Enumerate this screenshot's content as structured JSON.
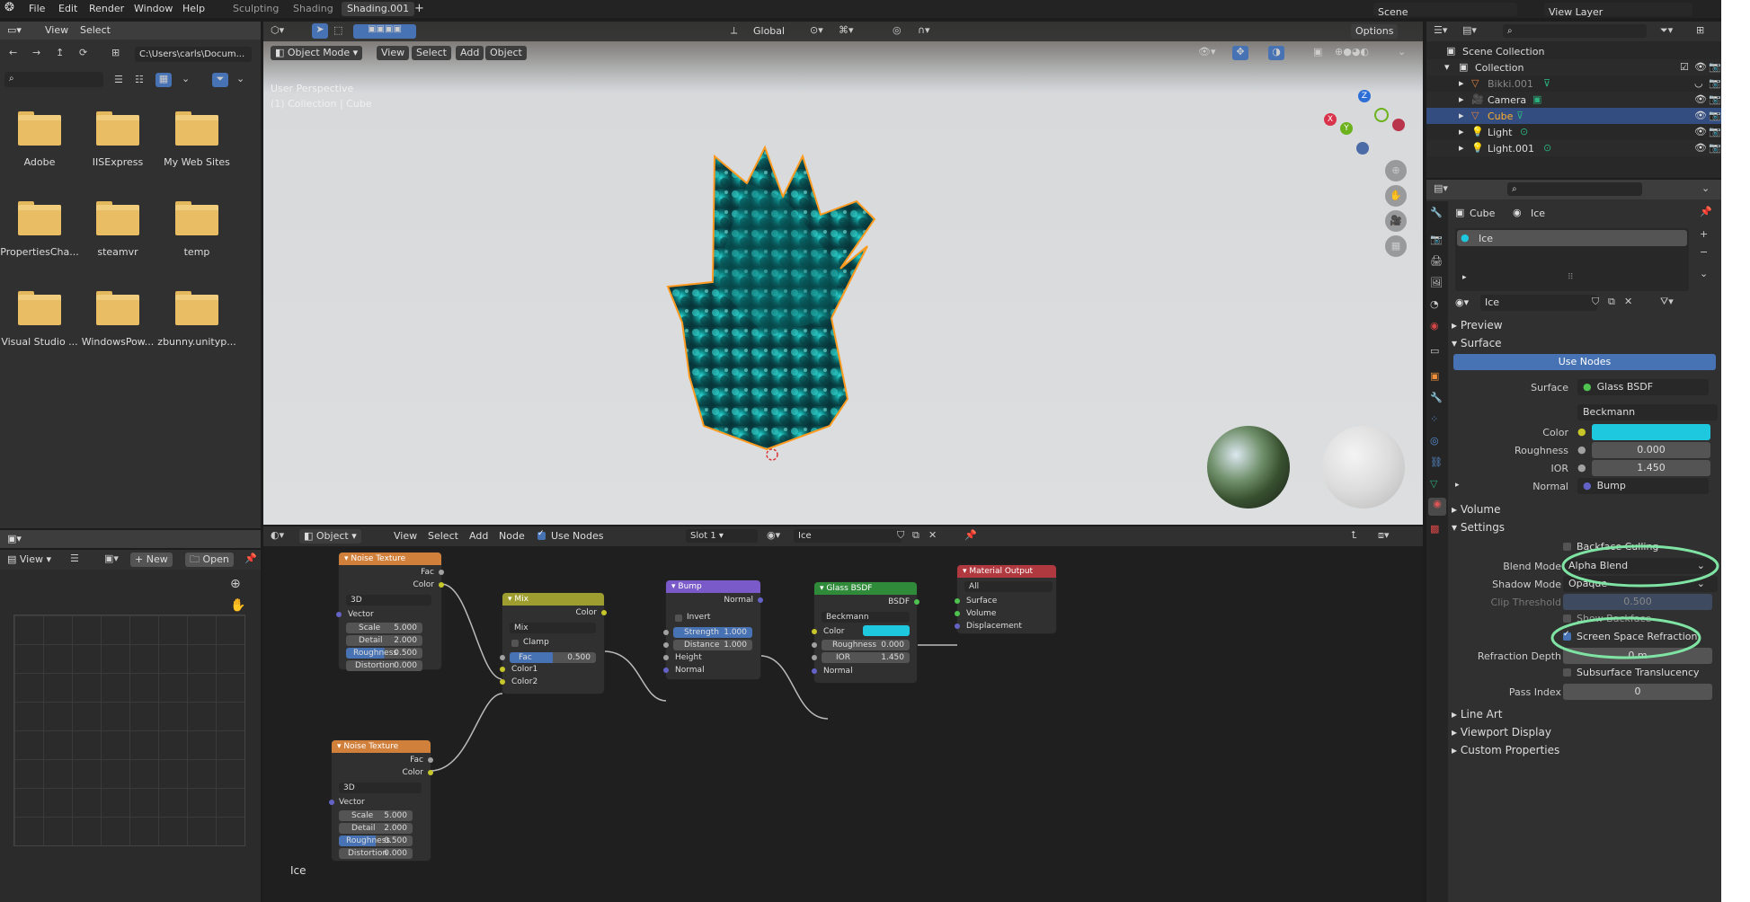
{
  "menubar": {
    "items": [
      "File",
      "Edit",
      "Render",
      "Window",
      "Help"
    ],
    "tabs": [
      "Sculpting",
      "Shading",
      "Shading.001"
    ],
    "plus": "+",
    "scene_label": "Scene",
    "view_layer_label": "View Layer"
  },
  "filebrowser": {
    "menu": [
      "View",
      "Select"
    ],
    "path": "C:\\Users\\carls\\Docum...",
    "folders": [
      "Adobe",
      "IISExpress",
      "My Web Sites",
      "PropertiesCha...",
      "steamvr",
      "temp",
      "Visual Studio ...",
      "WindowsPow...",
      "zbunny.unityp..."
    ]
  },
  "imageeditor": {
    "view": "View",
    "new": "New",
    "open": "Open"
  },
  "viewport": {
    "mode": "Object Mode",
    "menu": [
      "View",
      "Select",
      "Add",
      "Object"
    ],
    "orientation": "Global",
    "options": "Options",
    "line1": "User Perspective",
    "line2": "(1) Collection | Cube"
  },
  "nodeeditor": {
    "type": "Object",
    "menu": [
      "View",
      "Select",
      "Add",
      "Node"
    ],
    "use_nodes": "Use Nodes",
    "slot": "Slot 1",
    "material": "Ice",
    "frame_label": "Ice"
  },
  "nodes": {
    "noise1": {
      "title": "Noise Texture",
      "fac": "Fac",
      "color": "Color",
      "dim": "3D",
      "vector": "Vector",
      "scale": "Scale",
      "scale_v": "5.000",
      "detail": "Detail",
      "detail_v": "2.000",
      "rough": "Roughness",
      "rough_v": "0.500",
      "dist": "Distortion",
      "dist_v": "0.000"
    },
    "noise2": {
      "title": "Noise Texture",
      "fac": "Fac",
      "color": "Color",
      "dim": "3D",
      "vector": "Vector",
      "scale": "Scale",
      "scale_v": "5.000",
      "detail": "Detail",
      "detail_v": "2.000",
      "rough": "Roughness",
      "rough_v": "0.500",
      "dist": "Distortion",
      "dist_v": "0.000"
    },
    "mix": {
      "title": "Mix",
      "color": "Color",
      "mode": "Mix",
      "clamp": "Clamp",
      "fac": "Fac",
      "fac_v": "0.500",
      "c1": "Color1",
      "c2": "Color2"
    },
    "bump": {
      "title": "Bump",
      "normal": "Normal",
      "invert": "Invert",
      "strength": "Strength",
      "strength_v": "1.000",
      "distance": "Distance",
      "distance_v": "1.000",
      "height": "Height",
      "normal_in": "Normal"
    },
    "glass": {
      "title": "Glass BSDF",
      "bsdf": "BSDF",
      "dist": "Beckmann",
      "color": "Color",
      "rough": "Roughness",
      "rough_v": "0.000",
      "ior": "IOR",
      "ior_v": "1.450",
      "normal": "Normal",
      "swatch": "#1ec9e0"
    },
    "output": {
      "title": "Material Output",
      "target": "All",
      "surface": "Surface",
      "volume": "Volume",
      "disp": "Displacement"
    }
  },
  "outliner": {
    "root": "Scene Collection",
    "items": [
      {
        "name": "Collection"
      },
      {
        "name": "Bikki.001"
      },
      {
        "name": "Camera"
      },
      {
        "name": "Cube"
      },
      {
        "name": "Light"
      },
      {
        "name": "Light.001"
      }
    ]
  },
  "properties": {
    "crumb_obj": "Cube",
    "crumb_mat": "Ice",
    "slot": "Ice",
    "mat_name": "Ice",
    "preview": "Preview",
    "surface": "Surface",
    "use_nodes": "Use Nodes",
    "surface_lbl": "Surface",
    "surface_val": "Glass BSDF",
    "dist": "Beckmann",
    "color_lbl": "Color",
    "rough_lbl": "Roughness",
    "rough_val": "0.000",
    "ior_lbl": "IOR",
    "ior_val": "1.450",
    "normal_lbl": "Normal",
    "normal_val": "Bump",
    "volume": "Volume",
    "settings": "Settings",
    "backface": "Backface Culling",
    "blend_lbl": "Blend Mode",
    "blend_val": "Alpha Blend",
    "shadow_lbl": "Shadow Mode",
    "shadow_val": "Opaque",
    "clip_lbl": "Clip Threshold",
    "clip_val": "0.500",
    "show_backface": "Show Backface",
    "ssr": "Screen Space Refraction",
    "refr_lbl": "Refraction Depth",
    "refr_val": "0 m",
    "sss": "Subsurface Translucency",
    "pass_lbl": "Pass Index",
    "pass_val": "0",
    "line_art": "Line Art",
    "viewport_display": "Viewport Display",
    "custom_props": "Custom Properties",
    "color_swatch": "#1ec9e0"
  }
}
